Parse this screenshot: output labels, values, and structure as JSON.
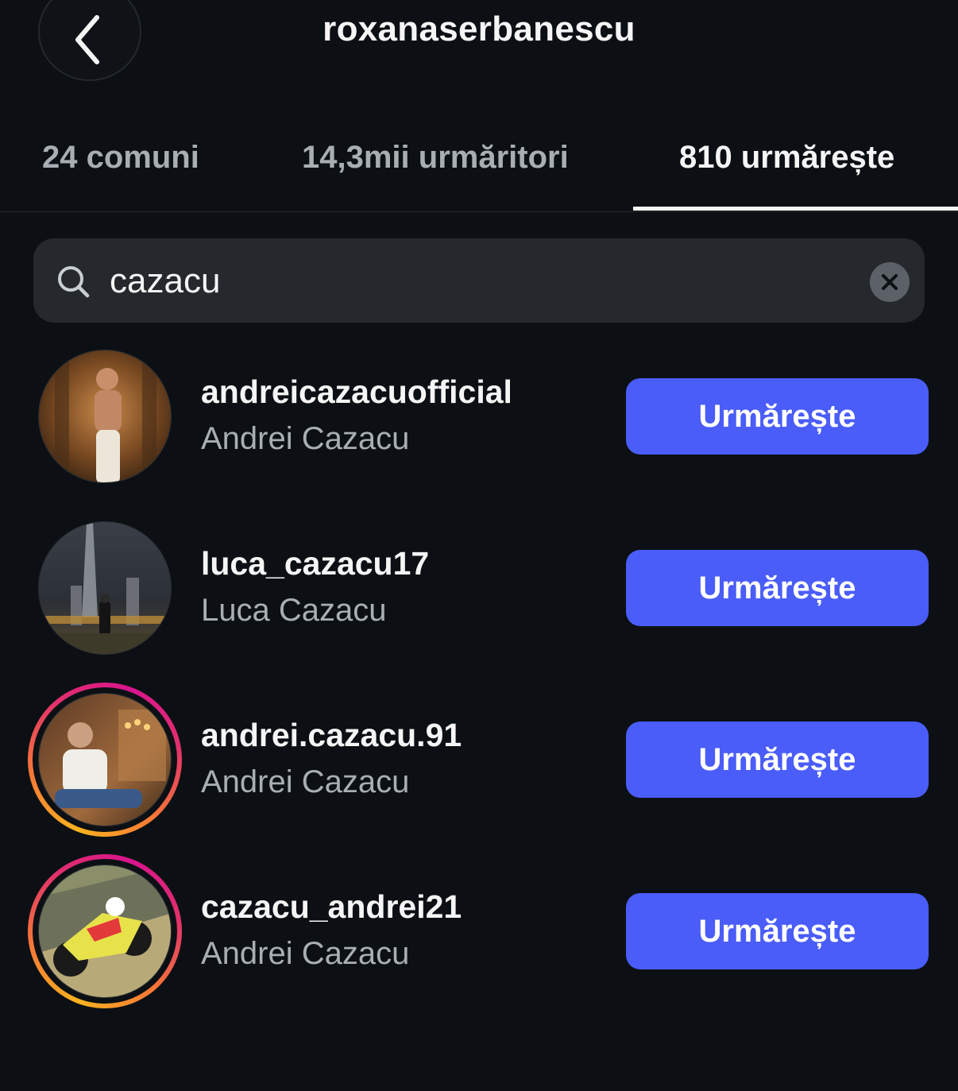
{
  "header": {
    "title": "roxanaserbanescu",
    "back_icon": "chevron-left-icon"
  },
  "tabs": [
    {
      "label": "24 comuni",
      "active": false
    },
    {
      "label": "14,3mii urmăritori",
      "active": false
    },
    {
      "label": "810 urmărește",
      "active": true
    }
  ],
  "search": {
    "value": "cazacu",
    "icon": "search-icon",
    "clear_icon": "close-icon"
  },
  "results": [
    {
      "username": "andreicazacuofficial",
      "full_name": "Andrei Cazacu",
      "button": "Urmărește",
      "has_story": false
    },
    {
      "username": "luca_cazacu17",
      "full_name": "Luca Cazacu",
      "button": "Urmărește",
      "has_story": false
    },
    {
      "username": "andrei.cazacu.91",
      "full_name": "Andrei Cazacu",
      "button": "Urmărește",
      "has_story": true
    },
    {
      "username": "cazacu_andrei21",
      "full_name": "Andrei Cazacu",
      "button": "Urmărește",
      "has_story": true
    }
  ],
  "colors": {
    "background": "#0c1014",
    "button": "#4a5df9",
    "search_bg": "#25292e",
    "secondary_text": "#a8aeb4"
  }
}
